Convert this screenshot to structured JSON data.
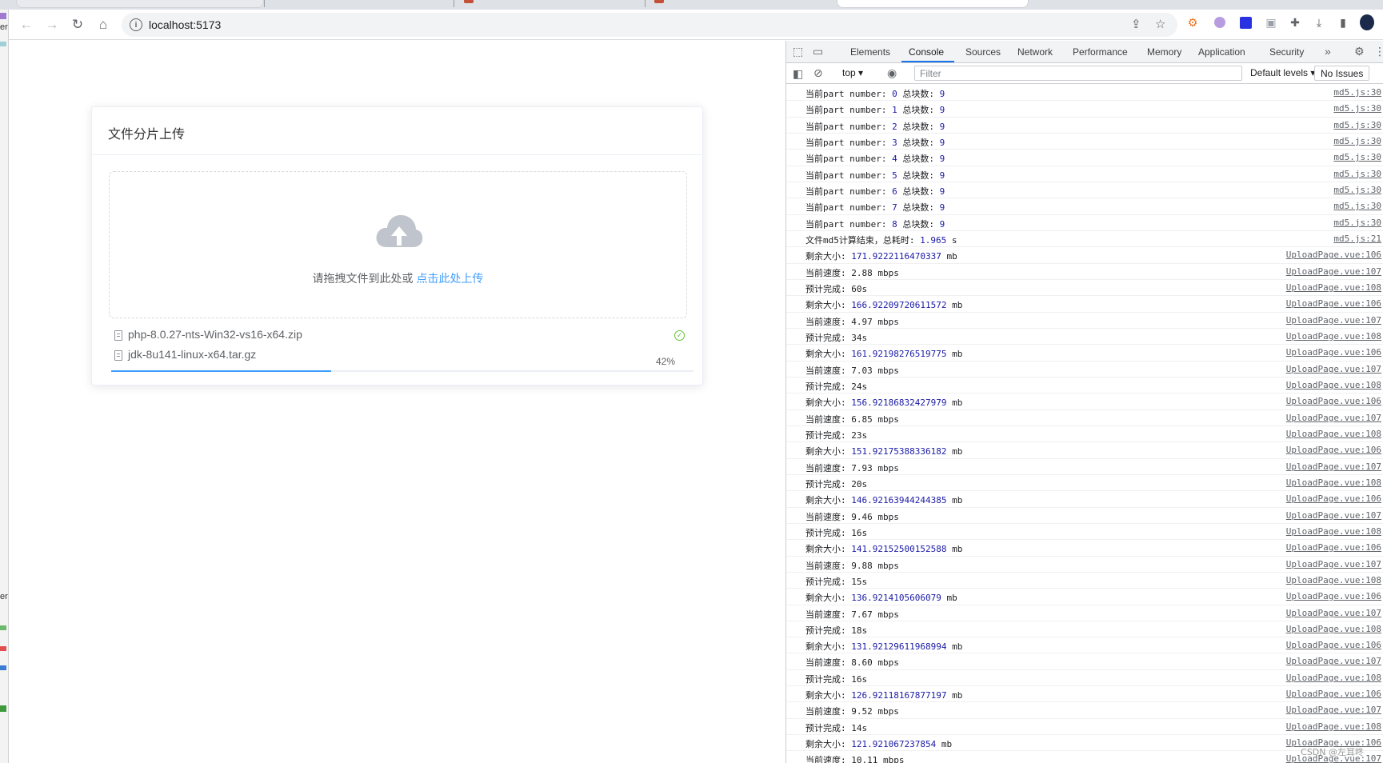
{
  "browser": {
    "url": "localhost:5173",
    "left_strip_text": [
      "er",
      "er"
    ]
  },
  "upload_card": {
    "title": "文件分片上传",
    "drop_text": "请拖拽文件到此处或",
    "drop_link": "点击此处上传",
    "files": [
      {
        "name": "php-8.0.27-nts-Win32-vs16-x64.zip",
        "status": "success"
      },
      {
        "name": "jdk-8u141-linux-x64.tar.gz",
        "status": "uploading",
        "progress_text": "42%",
        "progress": 42
      }
    ]
  },
  "devtools": {
    "tabs": [
      "Elements",
      "Console",
      "Sources",
      "Network",
      "Performance",
      "Memory",
      "Application",
      "Security"
    ],
    "active_tab": "Console",
    "context": "top",
    "filter_placeholder": "Filter",
    "levels": "Default levels",
    "issues": "No Issues",
    "console_rows": [
      {
        "label": "当前part number:",
        "num": "0",
        "label2": "总块数:",
        "num2": "9",
        "unit": "",
        "src": "md5.js:30"
      },
      {
        "label": "当前part number:",
        "num": "1",
        "label2": "总块数:",
        "num2": "9",
        "unit": "",
        "src": "md5.js:30"
      },
      {
        "label": "当前part number:",
        "num": "2",
        "label2": "总块数:",
        "num2": "9",
        "unit": "",
        "src": "md5.js:30"
      },
      {
        "label": "当前part number:",
        "num": "3",
        "label2": "总块数:",
        "num2": "9",
        "unit": "",
        "src": "md5.js:30"
      },
      {
        "label": "当前part number:",
        "num": "4",
        "label2": "总块数:",
        "num2": "9",
        "unit": "",
        "src": "md5.js:30"
      },
      {
        "label": "当前part number:",
        "num": "5",
        "label2": "总块数:",
        "num2": "9",
        "unit": "",
        "src": "md5.js:30"
      },
      {
        "label": "当前part number:",
        "num": "6",
        "label2": "总块数:",
        "num2": "9",
        "unit": "",
        "src": "md5.js:30"
      },
      {
        "label": "当前part number:",
        "num": "7",
        "label2": "总块数:",
        "num2": "9",
        "unit": "",
        "src": "md5.js:30"
      },
      {
        "label": "当前part number:",
        "num": "8",
        "label2": "总块数:",
        "num2": "9",
        "unit": "",
        "src": "md5.js:30"
      },
      {
        "label": "文件md5计算结束，总耗时:",
        "num": "1.965",
        "label2": "",
        "num2": "",
        "unit": "s",
        "src": "md5.js:21"
      },
      {
        "label": "剩余大小:",
        "num": "171.9222116470337",
        "label2": "",
        "num2": "",
        "unit": "mb",
        "src": "UploadPage.vue:106"
      },
      {
        "label": "当前速度:",
        "num": "",
        "label2": "",
        "num2": "",
        "unit": "2.88 mbps",
        "src": "UploadPage.vue:107"
      },
      {
        "label": "预计完成:",
        "num": "",
        "label2": "",
        "num2": "",
        "unit": "60s",
        "src": "UploadPage.vue:108"
      },
      {
        "label": "剩余大小:",
        "num": "166.92209720611572",
        "label2": "",
        "num2": "",
        "unit": "mb",
        "src": "UploadPage.vue:106"
      },
      {
        "label": "当前速度:",
        "num": "",
        "label2": "",
        "num2": "",
        "unit": "4.97 mbps",
        "src": "UploadPage.vue:107"
      },
      {
        "label": "预计完成:",
        "num": "",
        "label2": "",
        "num2": "",
        "unit": "34s",
        "src": "UploadPage.vue:108"
      },
      {
        "label": "剩余大小:",
        "num": "161.92198276519775",
        "label2": "",
        "num2": "",
        "unit": "mb",
        "src": "UploadPage.vue:106"
      },
      {
        "label": "当前速度:",
        "num": "",
        "label2": "",
        "num2": "",
        "unit": "7.03 mbps",
        "src": "UploadPage.vue:107"
      },
      {
        "label": "预计完成:",
        "num": "",
        "label2": "",
        "num2": "",
        "unit": "24s",
        "src": "UploadPage.vue:108"
      },
      {
        "label": "剩余大小:",
        "num": "156.92186832427979",
        "label2": "",
        "num2": "",
        "unit": "mb",
        "src": "UploadPage.vue:106"
      },
      {
        "label": "当前速度:",
        "num": "",
        "label2": "",
        "num2": "",
        "unit": "6.85 mbps",
        "src": "UploadPage.vue:107"
      },
      {
        "label": "预计完成:",
        "num": "",
        "label2": "",
        "num2": "",
        "unit": "23s",
        "src": "UploadPage.vue:108"
      },
      {
        "label": "剩余大小:",
        "num": "151.92175388336182",
        "label2": "",
        "num2": "",
        "unit": "mb",
        "src": "UploadPage.vue:106"
      },
      {
        "label": "当前速度:",
        "num": "",
        "label2": "",
        "num2": "",
        "unit": "7.93 mbps",
        "src": "UploadPage.vue:107"
      },
      {
        "label": "预计完成:",
        "num": "",
        "label2": "",
        "num2": "",
        "unit": "20s",
        "src": "UploadPage.vue:108"
      },
      {
        "label": "剩余大小:",
        "num": "146.92163944244385",
        "label2": "",
        "num2": "",
        "unit": "mb",
        "src": "UploadPage.vue:106"
      },
      {
        "label": "当前速度:",
        "num": "",
        "label2": "",
        "num2": "",
        "unit": "9.46 mbps",
        "src": "UploadPage.vue:107"
      },
      {
        "label": "预计完成:",
        "num": "",
        "label2": "",
        "num2": "",
        "unit": "16s",
        "src": "UploadPage.vue:108"
      },
      {
        "label": "剩余大小:",
        "num": "141.92152500152588",
        "label2": "",
        "num2": "",
        "unit": "mb",
        "src": "UploadPage.vue:106"
      },
      {
        "label": "当前速度:",
        "num": "",
        "label2": "",
        "num2": "",
        "unit": "9.88 mbps",
        "src": "UploadPage.vue:107"
      },
      {
        "label": "预计完成:",
        "num": "",
        "label2": "",
        "num2": "",
        "unit": "15s",
        "src": "UploadPage.vue:108"
      },
      {
        "label": "剩余大小:",
        "num": "136.9214105606079",
        "label2": "",
        "num2": "",
        "unit": "mb",
        "src": "UploadPage.vue:106"
      },
      {
        "label": "当前速度:",
        "num": "",
        "label2": "",
        "num2": "",
        "unit": "7.67 mbps",
        "src": "UploadPage.vue:107"
      },
      {
        "label": "预计完成:",
        "num": "",
        "label2": "",
        "num2": "",
        "unit": "18s",
        "src": "UploadPage.vue:108"
      },
      {
        "label": "剩余大小:",
        "num": "131.92129611968994",
        "label2": "",
        "num2": "",
        "unit": "mb",
        "src": "UploadPage.vue:106"
      },
      {
        "label": "当前速度:",
        "num": "",
        "label2": "",
        "num2": "",
        "unit": "8.60 mbps",
        "src": "UploadPage.vue:107"
      },
      {
        "label": "预计完成:",
        "num": "",
        "label2": "",
        "num2": "",
        "unit": "16s",
        "src": "UploadPage.vue:108"
      },
      {
        "label": "剩余大小:",
        "num": "126.92118167877197",
        "label2": "",
        "num2": "",
        "unit": "mb",
        "src": "UploadPage.vue:106"
      },
      {
        "label": "当前速度:",
        "num": "",
        "label2": "",
        "num2": "",
        "unit": "9.52 mbps",
        "src": "UploadPage.vue:107"
      },
      {
        "label": "预计完成:",
        "num": "",
        "label2": "",
        "num2": "",
        "unit": "14s",
        "src": "UploadPage.vue:108"
      },
      {
        "label": "剩余大小:",
        "num": "121.921067237854",
        "label2": "",
        "num2": "",
        "unit": "mb",
        "src": "UploadPage.vue:106"
      },
      {
        "label": "当前速度:",
        "num": "",
        "label2": "",
        "num2": "",
        "unit": "10.11 mbps",
        "src": "UploadPage.vue:107"
      }
    ],
    "watermark": "CSDN @左耳咚"
  },
  "colors": {
    "accent": "#409eff",
    "success": "#67c23a",
    "link": "#1a73e8",
    "number": "#1a1aa6"
  }
}
